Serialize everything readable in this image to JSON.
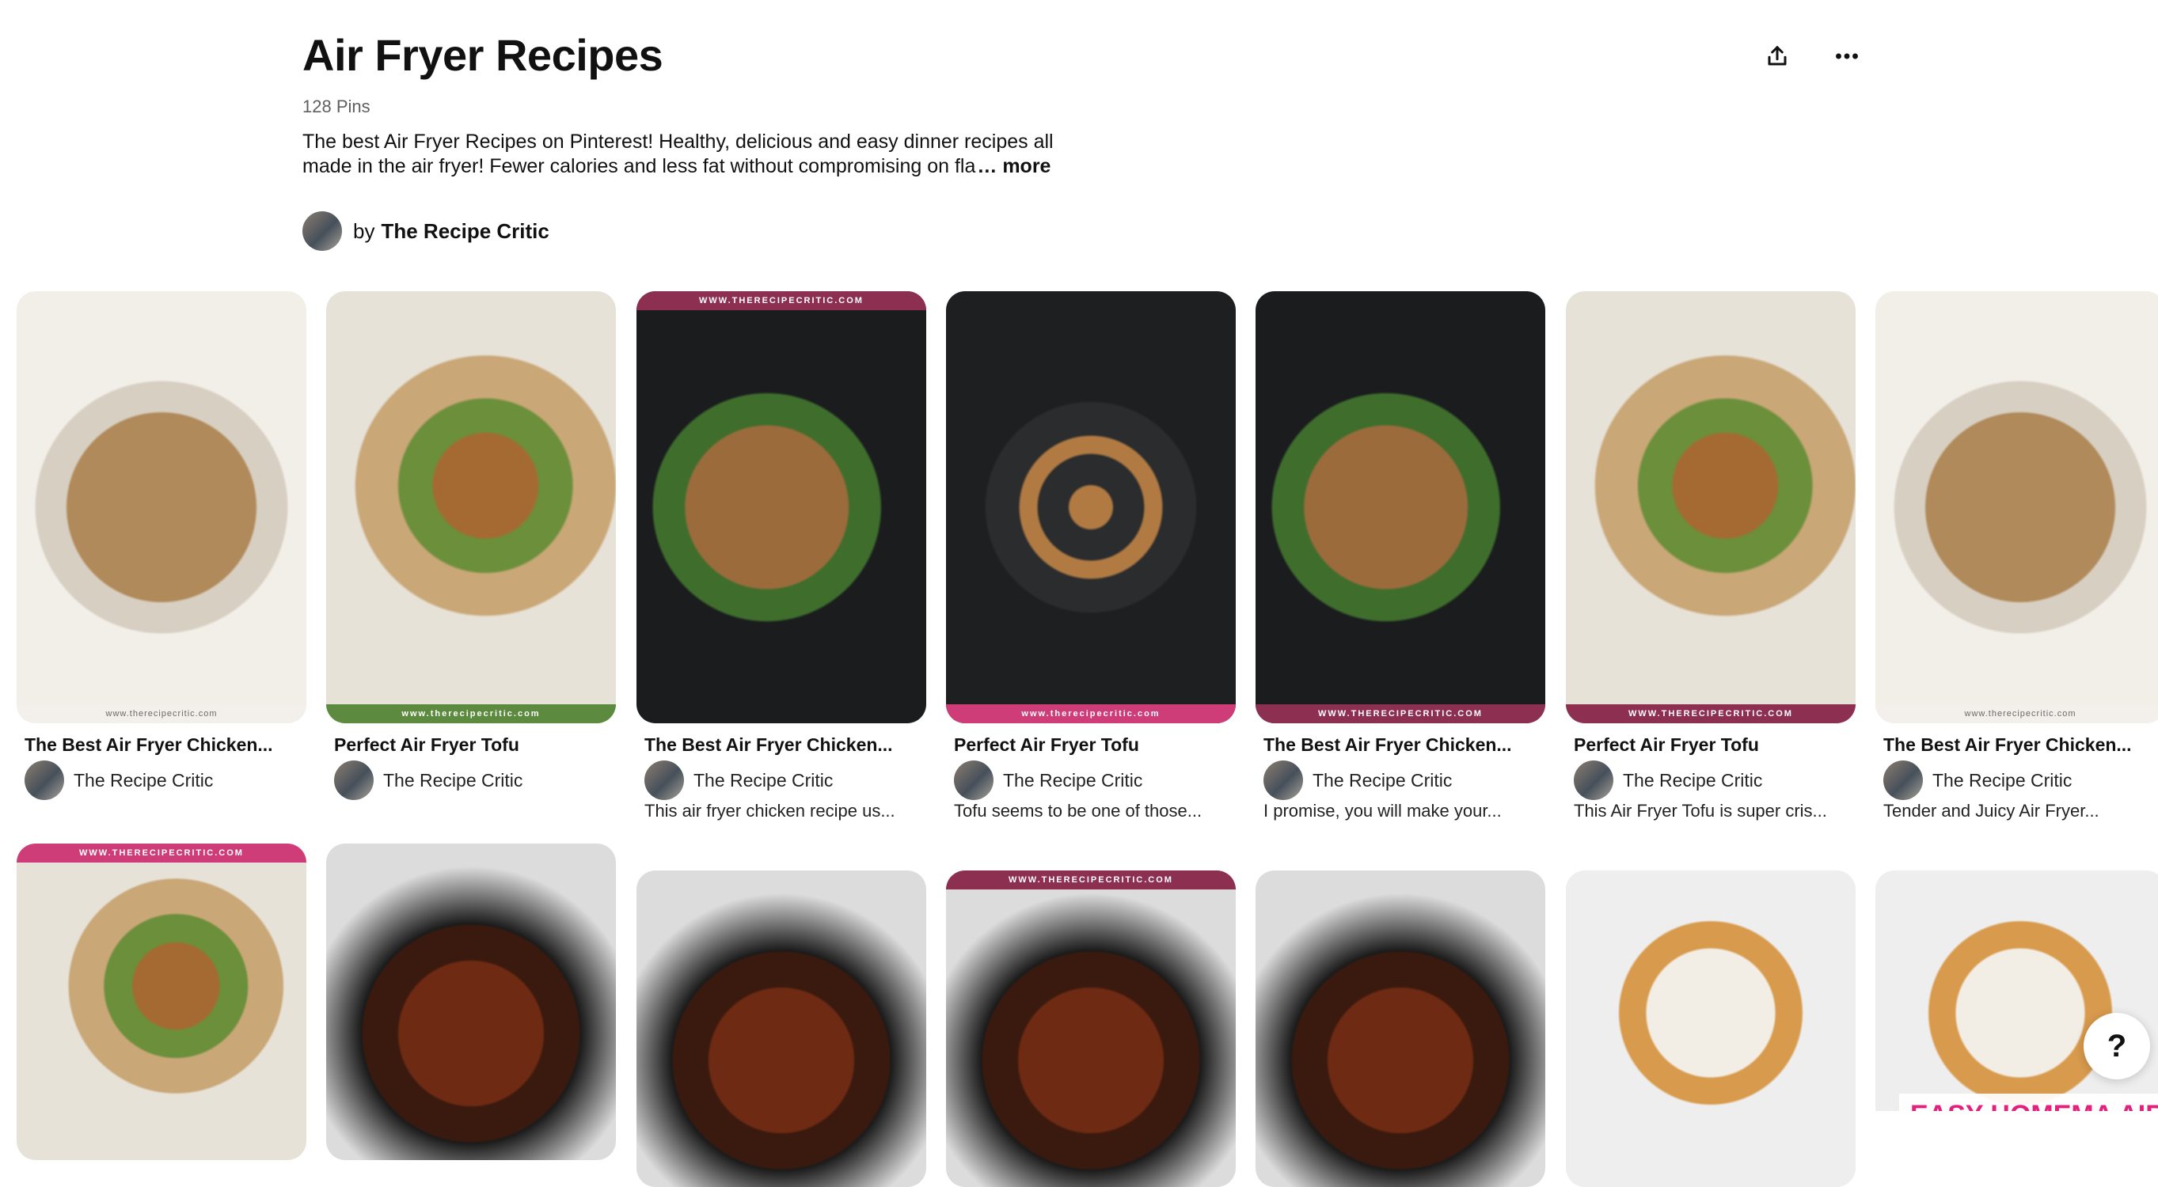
{
  "board": {
    "title": "Air Fryer Recipes",
    "pin_count": "128 Pins",
    "description": "The best Air Fryer Recipes on Pinterest! Healthy, delicious and easy dinner recipes all made in the air fryer! Fewer calories and less fat without compromising on fla",
    "more_label": "… more",
    "by_label": "by",
    "owner_name": "The Recipe Critic"
  },
  "actions": {
    "share_icon": "share-icon",
    "more_icon": "more-horizontal-icon"
  },
  "pins_row1": [
    {
      "title": "The Best Air Fryer Chicken...",
      "author": "The Recipe Critic",
      "description": "",
      "watermark": "www.therecipecritic.com"
    },
    {
      "title": "Perfect Air Fryer Tofu",
      "author": "The Recipe Critic",
      "description": "",
      "watermark": "www.therecipecritic.com"
    },
    {
      "title": "The Best Air Fryer Chicken...",
      "author": "The Recipe Critic",
      "description": "This air fryer chicken recipe us...",
      "watermark": "WWW.THERECIPECRITIC.COM"
    },
    {
      "title": "Perfect Air Fryer Tofu",
      "author": "The Recipe Critic",
      "description": "Tofu seems to be one of those...",
      "watermark": "www.therecipecritic.com"
    },
    {
      "title": "The Best Air Fryer Chicken...",
      "author": "The Recipe Critic",
      "description": "I promise, you will make your...",
      "watermark": "WWW.THERECIPECRITIC.COM"
    },
    {
      "title": "Perfect Air Fryer Tofu",
      "author": "The Recipe Critic",
      "description": "This Air Fryer Tofu is super cris...",
      "watermark": "WWW.THERECIPECRITIC.COM"
    },
    {
      "title": "The Best Air Fryer Chicken...",
      "author": "The Recipe Critic",
      "description": "Tender and Juicy Air Fryer...",
      "watermark": "www.therecipecritic.com"
    }
  ],
  "pins_row2": [
    {
      "watermark": "WWW.THERECIPECRITIC.COM"
    },
    {
      "watermark": ""
    },
    {
      "watermark": ""
    },
    {
      "watermark": "WWW.THERECIPECRITIC.COM"
    },
    {
      "watermark": ""
    },
    {
      "watermark": ""
    },
    {
      "watermark": "",
      "overlay_text": "EASY HOMEMA AIR FRYER POP TARTS"
    }
  ],
  "help": {
    "label": "?"
  },
  "colors": {
    "text": "#111111",
    "muted": "#5f5f5f",
    "watermark_pink": "#cf3d78",
    "watermark_maroon": "#8c2f50",
    "overlay_pink": "#e2217c"
  }
}
